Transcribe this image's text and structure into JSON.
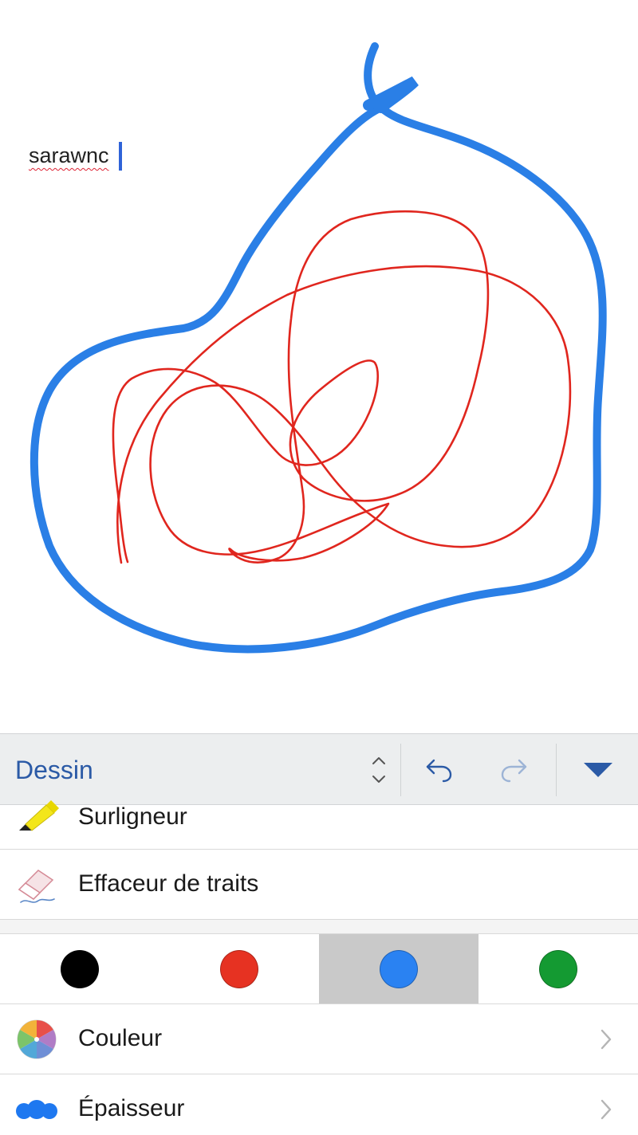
{
  "document": {
    "text": "sarawnc",
    "ink_strokes": [
      {
        "name": "blue-loop-stroke",
        "color": "#2a7fe6"
      },
      {
        "name": "red-scribble-stroke",
        "color": "#e0261e"
      }
    ]
  },
  "toolbar": {
    "tab_label": "Dessin",
    "icons": {
      "tab_switcher": "up-down-chevron-icon",
      "undo": "undo-icon",
      "redo": "redo-icon",
      "collapse": "triangle-down-icon"
    },
    "accent_color": "#2b5aa6"
  },
  "ribbon": {
    "rows": [
      {
        "label": "Surligneur",
        "icon": "highlighter-icon"
      },
      {
        "label": "Effaceur de traits",
        "icon": "eraser-icon"
      }
    ],
    "swatches": [
      {
        "color": "#000000",
        "selected": false
      },
      {
        "color": "#e63222",
        "selected": false
      },
      {
        "color": "#2a82f2",
        "selected": true
      },
      {
        "color": "#149a32",
        "selected": false
      }
    ],
    "color_row": {
      "label": "Couleur",
      "icon": "color-wheel-icon",
      "chevron": "chevron-right-icon"
    },
    "thickness_row": {
      "label": "Épaisseur",
      "icon": "thickness-blobs-icon",
      "chevron": "chevron-right-icon"
    }
  }
}
